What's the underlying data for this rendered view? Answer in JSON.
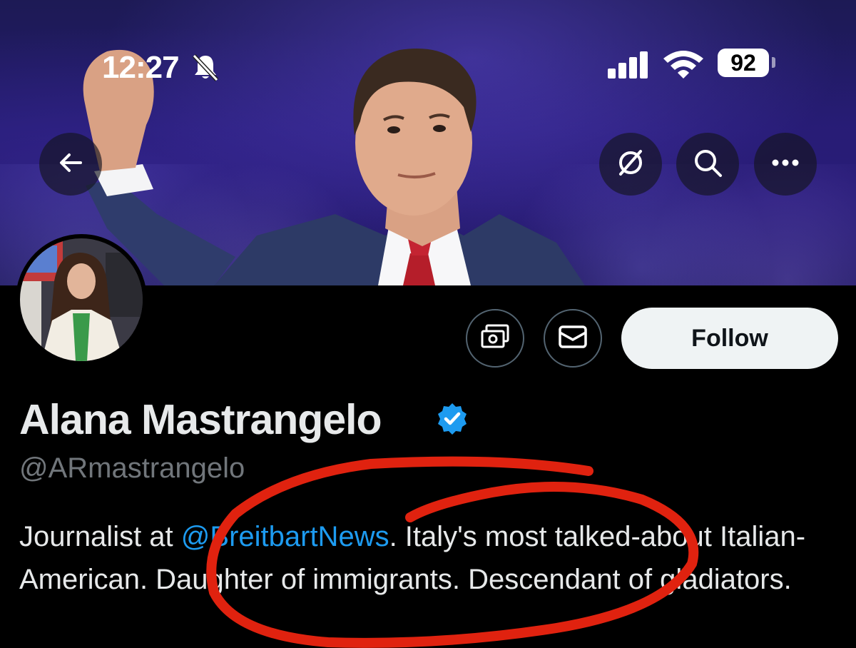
{
  "status_bar": {
    "time": "12:27",
    "battery": "92",
    "icons": [
      "bell-slash-icon",
      "signal-icon",
      "wifi-icon",
      "battery-icon"
    ]
  },
  "header": {
    "back_icon": "arrow-left-icon",
    "grok_icon": "grok-icon",
    "search_icon": "search-icon",
    "more_icon": "more-icon"
  },
  "profile": {
    "name": "Alana Mastrangelo",
    "handle": "@ARmastrangelo",
    "verified": true,
    "verified_color": "#1d9bf0",
    "bio_prefix": "Journalist at ",
    "bio_mention": "@BreitbartNews",
    "bio_suffix": ". Italy's most talked-about Italian-American. Daughter of immigrants. Descendant of gladiators."
  },
  "actions": {
    "tip_icon": "money-icon",
    "message_icon": "envelope-icon",
    "follow_label": "Follow"
  },
  "colors": {
    "background": "#000000",
    "mention": "#1d9bf0",
    "annotation": "#e0220f"
  }
}
